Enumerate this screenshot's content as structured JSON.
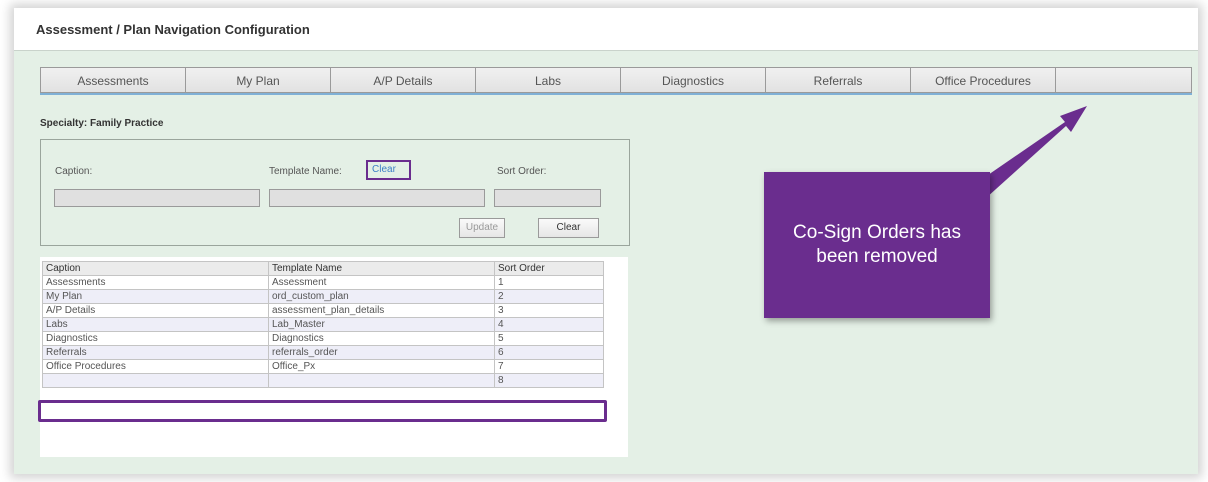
{
  "window": {
    "title": "Assessment / Plan Navigation Configuration"
  },
  "tabs": [
    {
      "label": "Assessments"
    },
    {
      "label": "My Plan"
    },
    {
      "label": "A/P Details"
    },
    {
      "label": "Labs"
    },
    {
      "label": "Diagnostics"
    },
    {
      "label": "Referrals"
    },
    {
      "label": "Office Procedures"
    }
  ],
  "specialty": {
    "label": "Specialty: Family Practice"
  },
  "form": {
    "caption_label": "Caption:",
    "template_label": "Template Name:",
    "clear_link": "Clear",
    "sort_label": "Sort Order:",
    "caption_value": "",
    "template_value": "",
    "sort_value": "",
    "update_button": "Update",
    "clear_button": "Clear"
  },
  "grid": {
    "columns": [
      "Caption",
      "Template Name",
      "Sort Order"
    ],
    "rows": [
      [
        "Assessments",
        "Assessment",
        "1"
      ],
      [
        "My Plan",
        "ord_custom_plan",
        "2"
      ],
      [
        "A/P Details",
        "assessment_plan_details",
        "3"
      ],
      [
        "Labs",
        "Lab_Master",
        "4"
      ],
      [
        "Diagnostics",
        "Diagnostics",
        "5"
      ],
      [
        "Referrals",
        "referrals_order",
        "6"
      ],
      [
        "Office Procedures",
        "Office_Px",
        "7"
      ],
      [
        "",
        "",
        "8"
      ]
    ]
  },
  "annotation": {
    "text": "Co-Sign Orders has been removed",
    "color": "#6a2d8e"
  }
}
